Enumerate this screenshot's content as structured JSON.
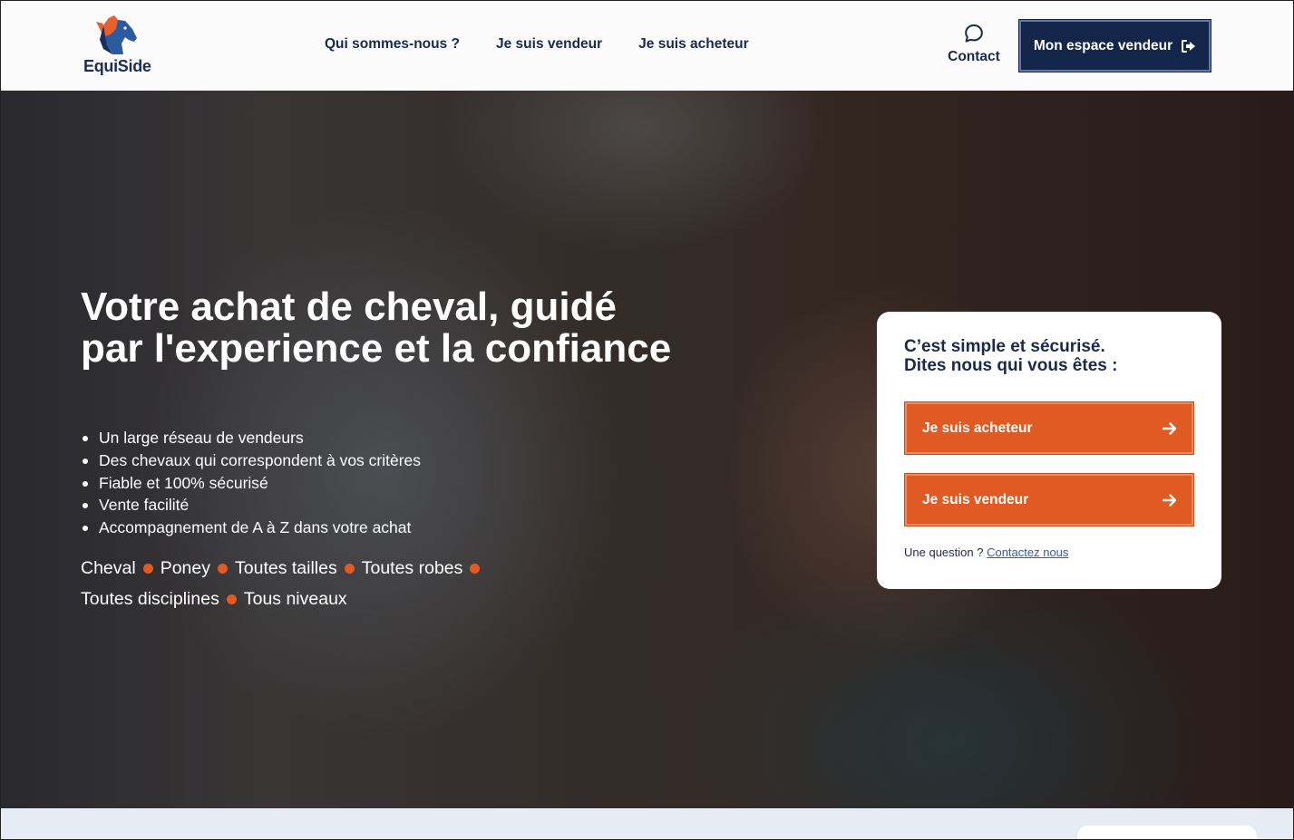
{
  "brand": {
    "name": "EquiSide",
    "colors": {
      "navy": "#14254a",
      "orange": "#e05a23",
      "accent_blue": "#2e5ca8"
    },
    "logo_icon": "horse-head-logo"
  },
  "nav": {
    "items": [
      {
        "label": "Qui sommes-nous ?"
      },
      {
        "label": "Je suis vendeur"
      },
      {
        "label": "Je suis acheteur"
      }
    ],
    "contact_label": "Contact",
    "contact_icon": "chat-bubble-icon",
    "seller_space_label": "Mon espace vendeur",
    "seller_space_icon": "sign-out-icon"
  },
  "hero": {
    "title": "Votre achat de cheval, guidé par l'experience et la confiance",
    "bullets": [
      "Un large réseau de vendeurs",
      "Des chevaux qui correspondent à vos critères",
      "Fiable et 100% sécurisé",
      "Vente facilité",
      "Accompagnement de A à Z dans votre achat"
    ],
    "tags": [
      "Cheval",
      "Poney",
      "Toutes tailles",
      "Toutes robes",
      "Toutes disciplines",
      "Tous niveaux"
    ]
  },
  "card": {
    "title_line1": "C’est simple et sécurisé.",
    "title_line2": "Dites nous qui vous êtes :",
    "buyer_button": "Je suis acheteur",
    "seller_button": "Je suis vendeur",
    "button_icon": "arrow-right-icon",
    "question_text": "Une question ?",
    "contact_link": "Contactez nous"
  }
}
